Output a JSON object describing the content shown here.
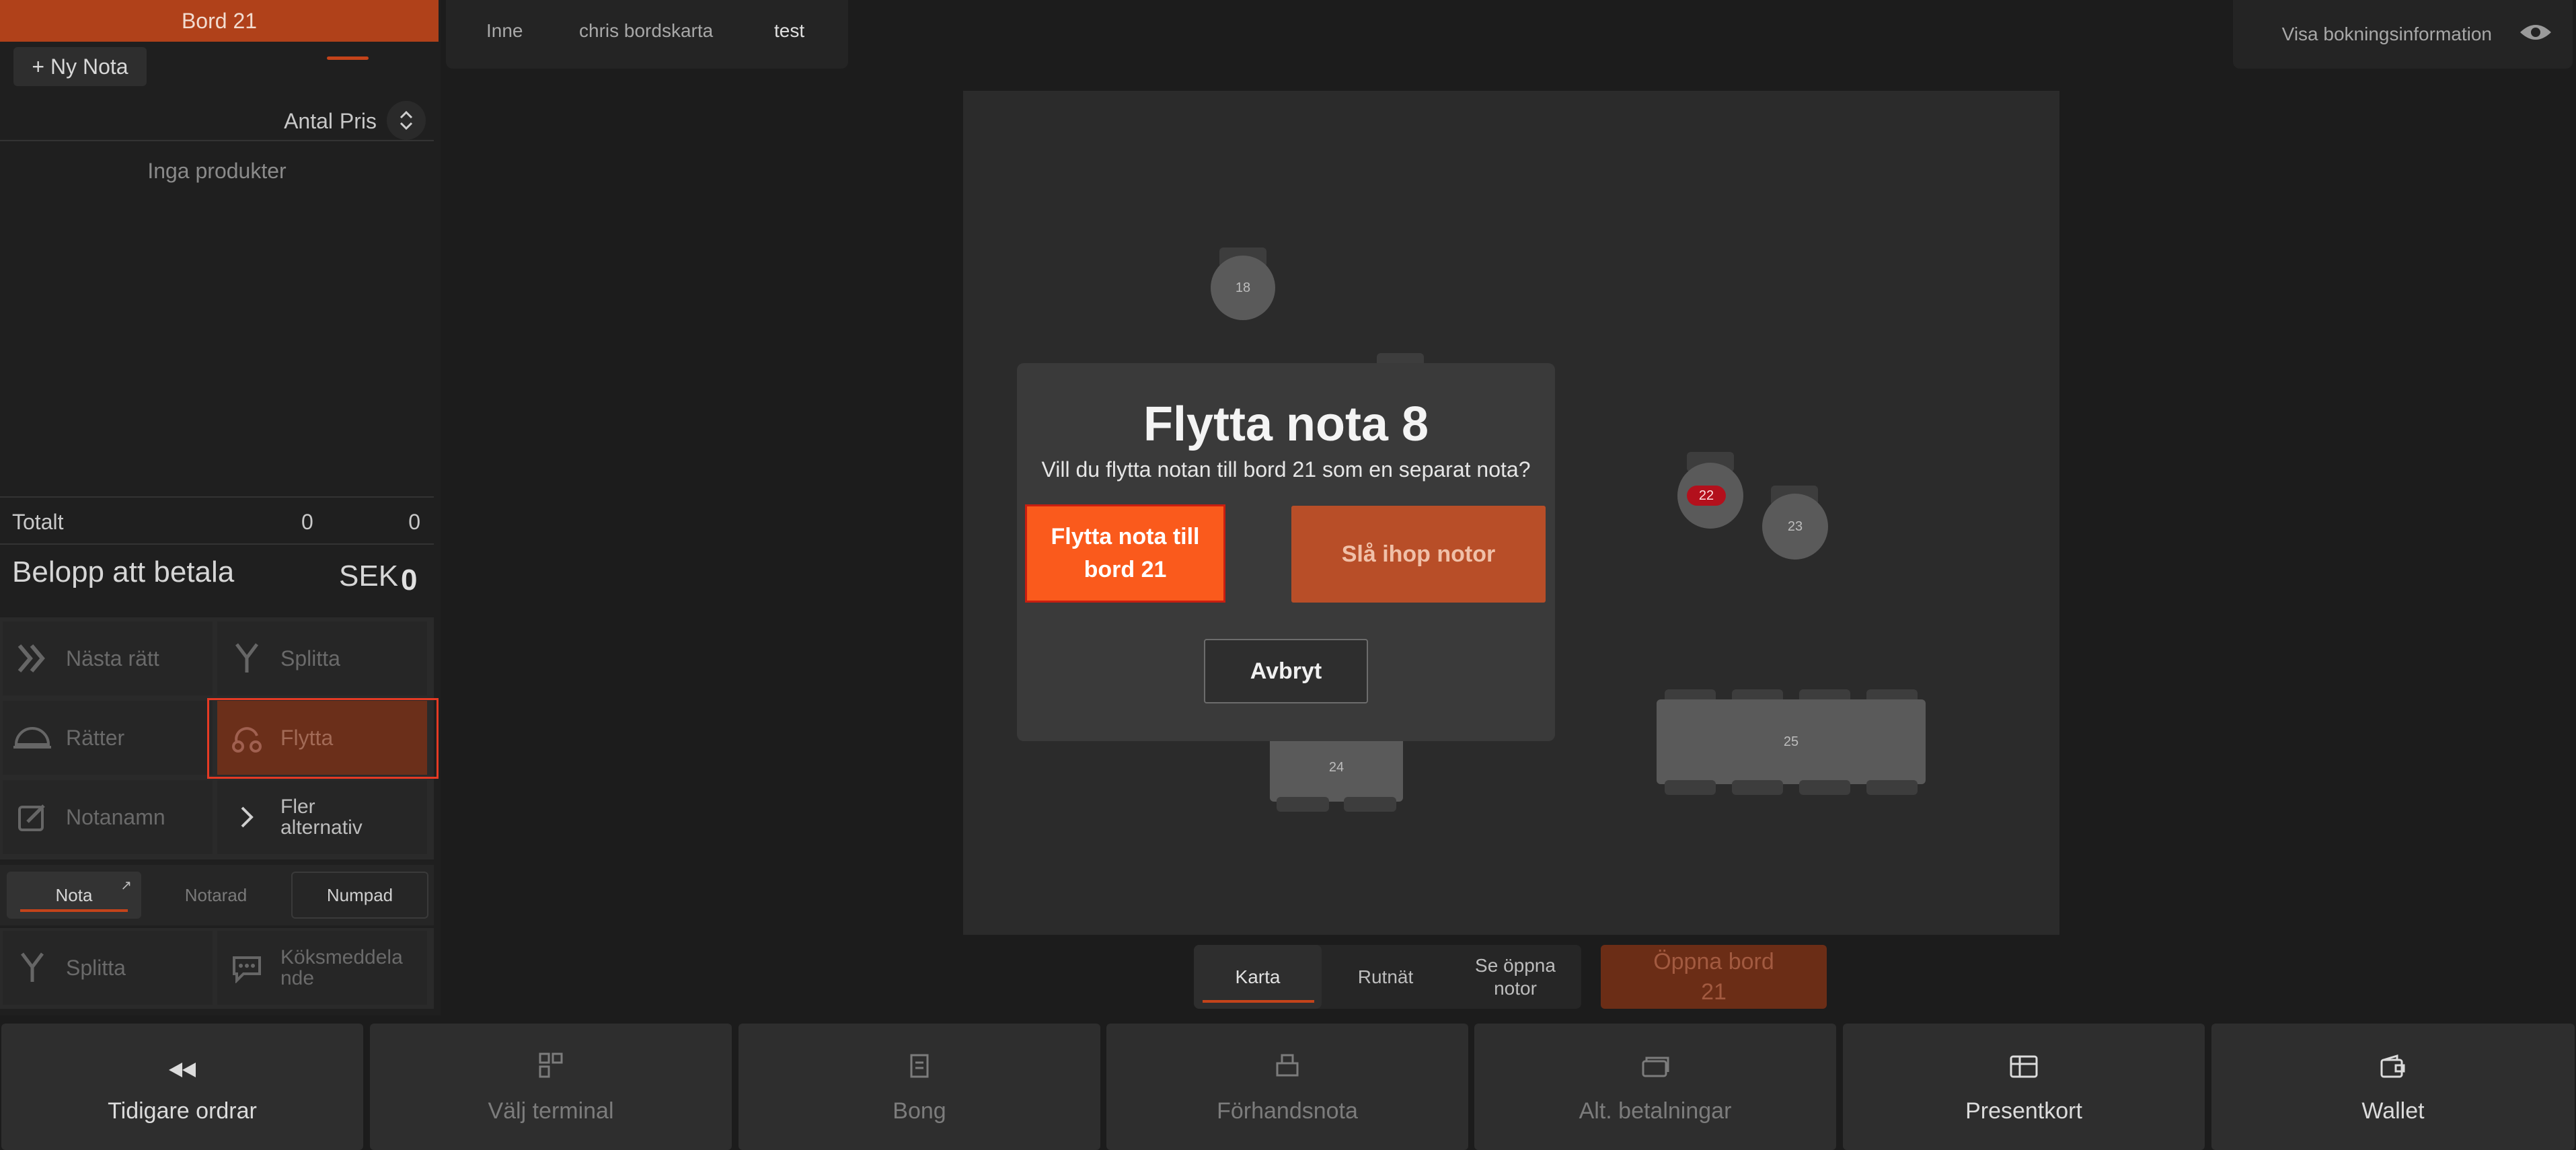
{
  "left_panel": {
    "table_header": "Bord 21",
    "new_note_label": "+ Ny Nota",
    "col_antal": "Antal",
    "col_pris": "Pris",
    "empty_text": "Inga produkter",
    "totalt_label": "Totalt",
    "totalt_antal": "0",
    "totalt_pris": "0",
    "belopp_label": "Belopp att betala",
    "belopp_currency": "SEK",
    "belopp_value": "0",
    "actions": {
      "nasta_ratt": "Nästa rätt",
      "splitta": "Splitta",
      "ratter": "Rätter",
      "flytta": "Flytta",
      "notanamn": "Notanamn",
      "fler_line1": "Fler",
      "fler_line2": "alternativ"
    },
    "note_tabs": {
      "nota": "Nota",
      "notarad": "Notarad",
      "numpad": "Numpad"
    },
    "bottom_actions": {
      "splitta": "Splitta",
      "koksmeddelande_line1": "Köksmeddela",
      "koksmeddelande_line2": "nde"
    }
  },
  "top_tabs": [
    "Inne",
    "chris bordskarta",
    "test"
  ],
  "active_top_tab": "test",
  "booking_info_label": "Visa bokningsinformation",
  "map": {
    "tables": {
      "t18": "18",
      "t22": "22",
      "t23": "23",
      "t24": "24",
      "t25": "25"
    }
  },
  "view_tabs": {
    "karta": "Karta",
    "rutnat": "Rutnät",
    "se_oppna_line1": "Se öppna",
    "se_oppna_line2": "notor"
  },
  "open_table": {
    "line1": "Öppna bord",
    "line2": "21"
  },
  "bottom_bar": {
    "tidigare": "Tidigare ordrar",
    "valj_terminal": "Välj terminal",
    "bong": "Bong",
    "forhandsnota": "Förhandsnota",
    "alt_betalningar": "Alt. betalningar",
    "presentkort": "Presentkort",
    "wallet": "Wallet"
  },
  "modal": {
    "title": "Flytta nota 8",
    "text": "Vill du flytta notan till bord 21 som en separat nota?",
    "move_button": "Flytta nota till bord 21",
    "merge_button": "Slå ihop notor",
    "cancel_button": "Avbryt"
  },
  "colors": {
    "accent": "#c4431a",
    "primary_button": "#fa5a1c",
    "highlight_border": "#e53a24",
    "badge_red": "#b3101c"
  }
}
